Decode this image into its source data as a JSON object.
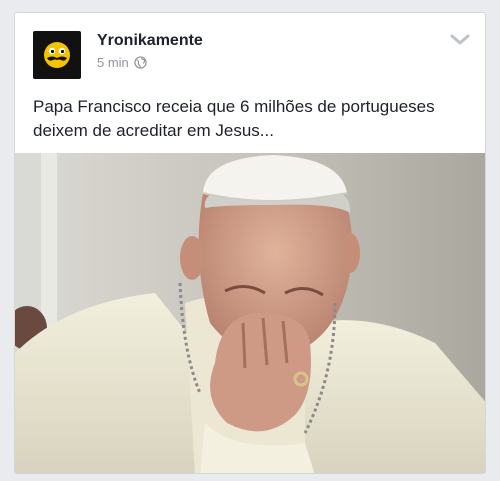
{
  "post": {
    "page_name": "Yronikamente",
    "timestamp": "5 min",
    "audience_icon": "globe-icon",
    "menu_icon": "chevron-down-icon",
    "text_line_1": "Papa Francisco receia que 6 milhões de portugueses",
    "text_line_2": "deixem de acreditar em Jesus...",
    "avatar_icon": "mustache-face-logo",
    "colors": {
      "avatar_bg": "#111111",
      "avatar_face": "#f5c400",
      "meta_text": "#90949c"
    }
  }
}
